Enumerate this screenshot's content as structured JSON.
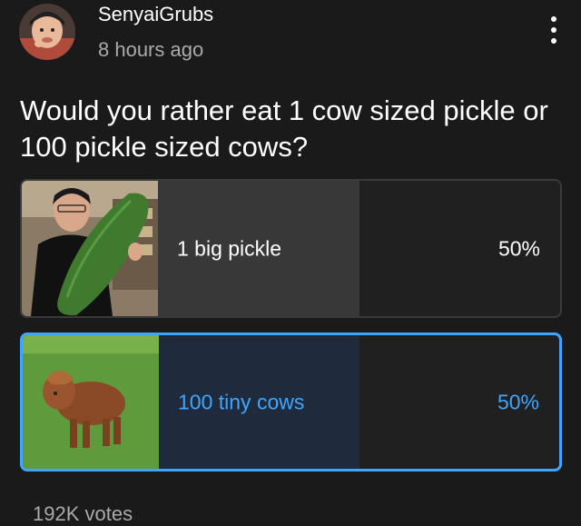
{
  "post": {
    "username": "SenyaiGrubs",
    "timestamp": "8 hours ago",
    "question": "Would you rather eat 1 cow sized pickle or 100 pickle sized cows?"
  },
  "poll": {
    "options": [
      {
        "label": "1 big pickle",
        "percent": "50%",
        "fill_fraction": 0.5,
        "selected": false,
        "image": "man-holding-giant-pickle"
      },
      {
        "label": "100 tiny cows",
        "percent": "50%",
        "fill_fraction": 0.5,
        "selected": true,
        "image": "highland-calf-on-grass"
      }
    ],
    "votes": "192K votes"
  },
  "colors": {
    "background": "#1a1a1a",
    "selected_accent": "#3ea6ff",
    "muted_text": "#aaaaaa"
  },
  "icons": {
    "menu": "more-vertical-icon",
    "avatar": "user-avatar"
  }
}
